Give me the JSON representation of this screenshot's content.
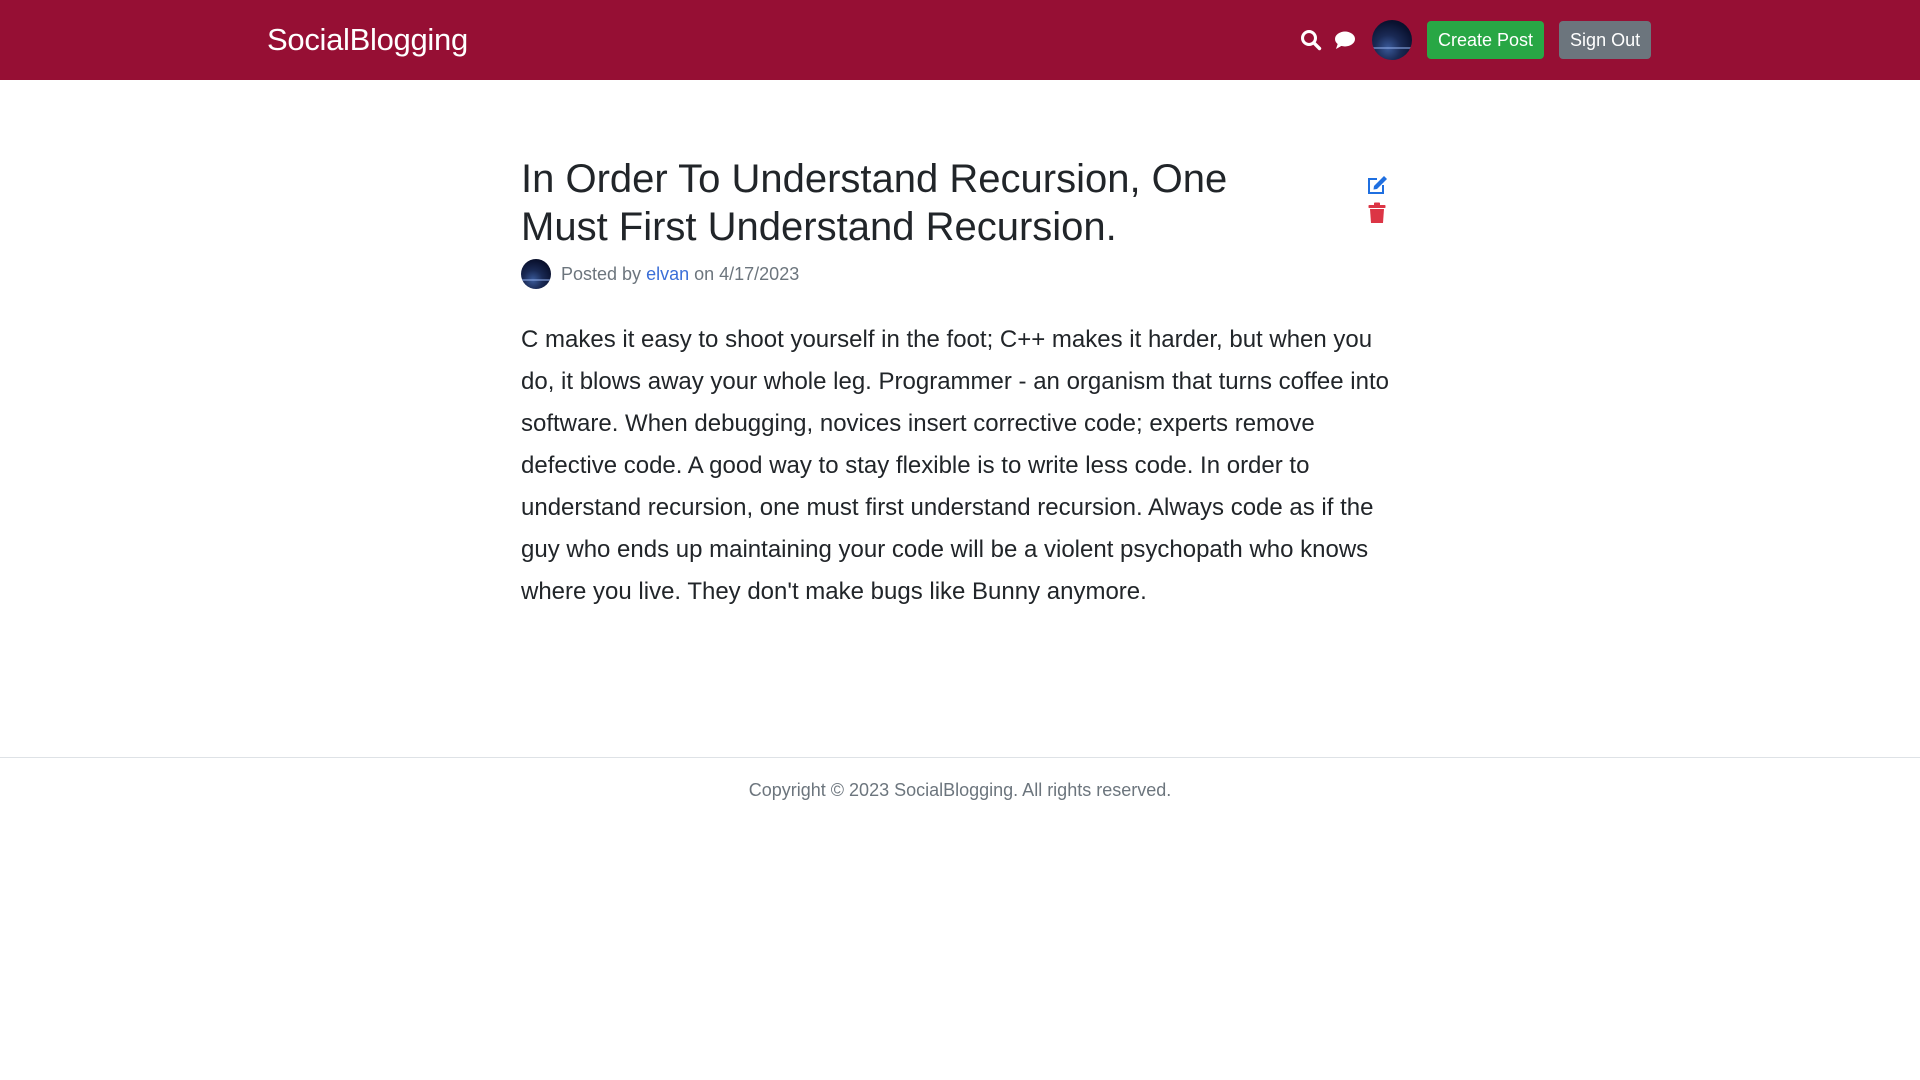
{
  "header": {
    "brand": "SocialBlogging",
    "search_icon": "search-icon",
    "chat_icon": "chat-icon",
    "create_post_label": "Create Post",
    "sign_out_label": "Sign Out"
  },
  "post": {
    "title": "In Order To Understand Recursion, One Must First Understand Recursion.",
    "posted_by_prefix": "Posted by",
    "author": "elvan",
    "date_prefix": "on",
    "date": "4/17/2023",
    "body": "C makes it easy to shoot yourself in the foot; C++ makes it harder, but when you do, it blows away your whole leg. Programmer - an organism that turns coffee into software. When debugging, novices insert corrective code; experts remove defective code. A good way to stay flexible is to write less code. In order to understand recursion, one must first understand recursion. Always code as if the guy who ends up maintaining your code will be a violent psychopath who knows where you live. They don't make bugs like Bunny anymore.",
    "edit_icon": "edit-icon",
    "delete_icon": "trash-icon"
  },
  "footer": {
    "copyright": "Copyright © 2023 SocialBlogging. All rights reserved."
  },
  "colors": {
    "navbar": "#960f34",
    "success": "#28a745",
    "secondary": "#6c757d",
    "link": "#3b6fd8",
    "delete": "#dc3545"
  }
}
